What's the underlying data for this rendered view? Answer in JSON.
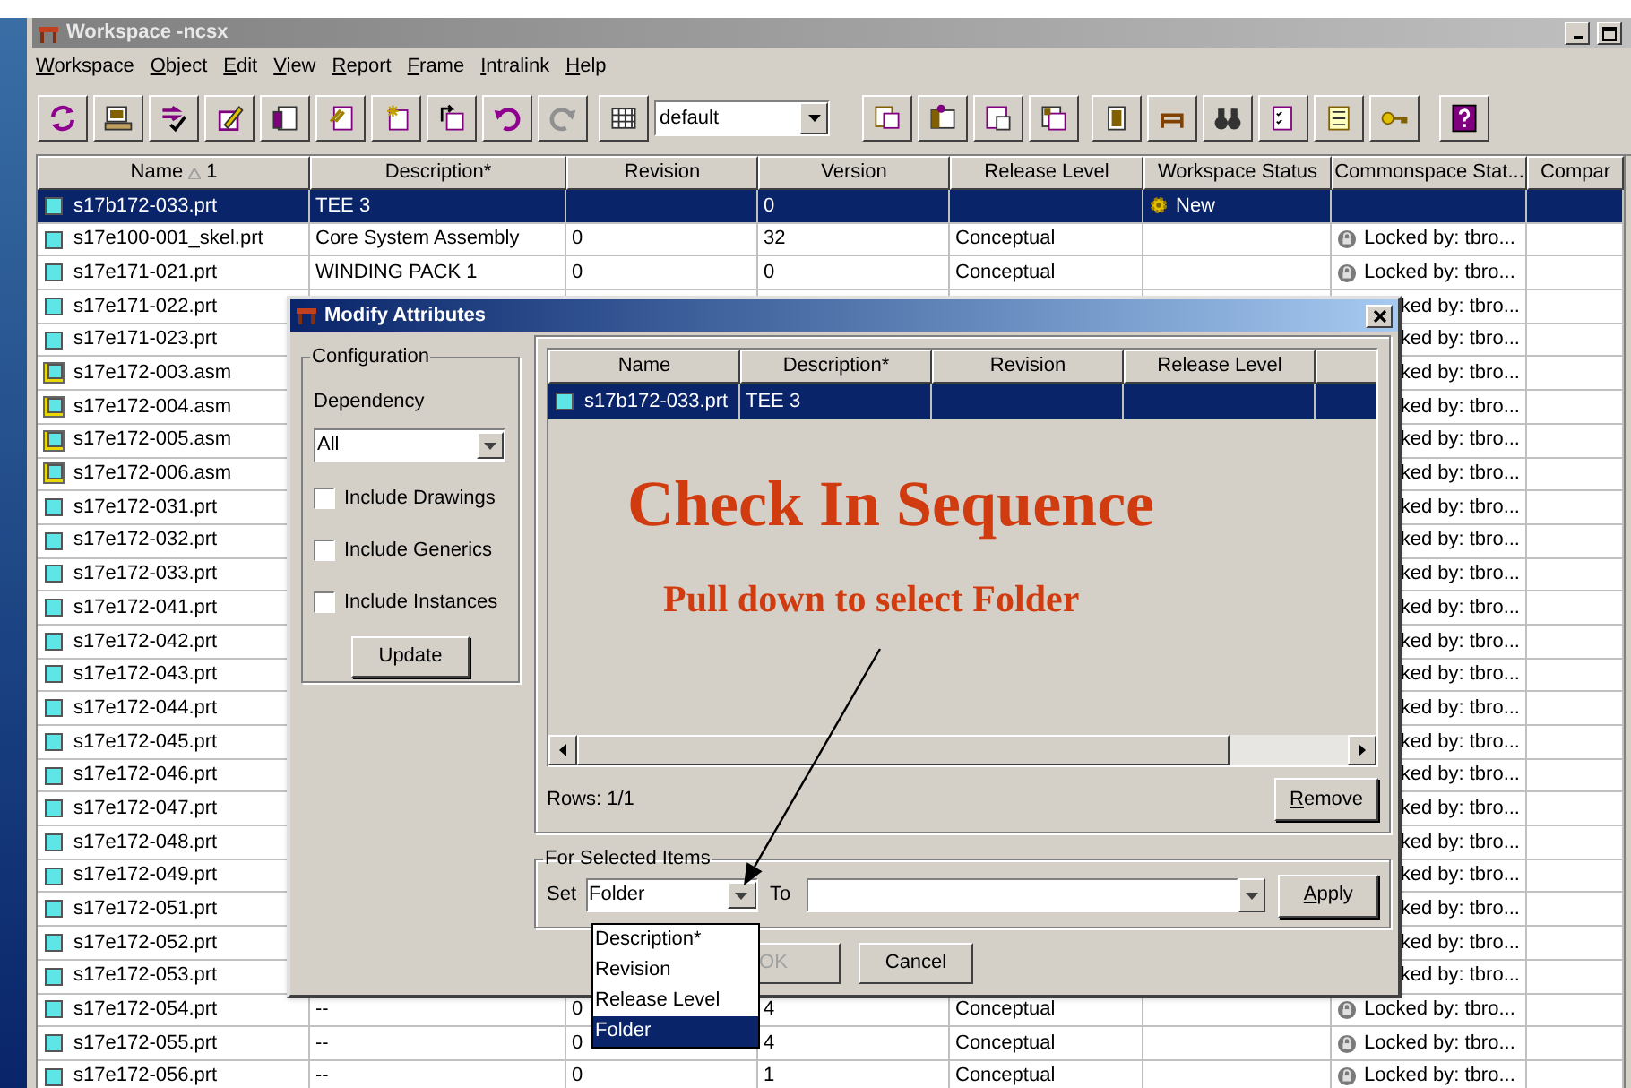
{
  "window": {
    "title": "Workspace -ncsx"
  },
  "menu": [
    "Workspace",
    "Object",
    "Edit",
    "View",
    "Report",
    "Frame",
    "Intralink",
    "Help"
  ],
  "toolbar": {
    "view_select": "default"
  },
  "table": {
    "columns": [
      {
        "label": "Name",
        "sort": "1"
      },
      {
        "label": "Description*"
      },
      {
        "label": "Revision"
      },
      {
        "label": "Version"
      },
      {
        "label": "Release Level"
      },
      {
        "label": "Workspace Status"
      },
      {
        "label": "Commonspace Stat..."
      },
      {
        "label": "Compar"
      }
    ],
    "rows": [
      {
        "kind": "prt",
        "name": "s17b172-033.prt",
        "description": "TEE 3",
        "version": "0",
        "workspace_status": "New",
        "lock": false,
        "selected": true
      },
      {
        "kind": "prt",
        "name": "s17e100-001_skel.prt",
        "description": "Core System Assembly",
        "revision": "0",
        "version": "32",
        "release_level": "Conceptual",
        "commonspace_status": "Locked by: tbro...",
        "lock": true,
        "selected": false
      },
      {
        "kind": "prt",
        "name": "s17e171-021.prt",
        "description": "WINDING PACK 1",
        "revision": "0",
        "version": "0",
        "release_level": "Conceptual",
        "commonspace_status": "Locked by: tbro...",
        "lock": true,
        "selected": false
      },
      {
        "kind": "prt",
        "name": "s17e171-022.prt",
        "commonspace_status": "ked by: tbro...",
        "lock": false,
        "selected": false
      },
      {
        "kind": "prt",
        "name": "s17e171-023.prt",
        "commonspace_status": "ked by: tbro...",
        "lock": false,
        "selected": false
      },
      {
        "kind": "asm",
        "name": "s17e172-003.asm",
        "commonspace_status": "ked by: tbro...",
        "lock": false,
        "selected": false
      },
      {
        "kind": "asm",
        "name": "s17e172-004.asm",
        "commonspace_status": "ked by: tbro...",
        "lock": false,
        "selected": false
      },
      {
        "kind": "asm",
        "name": "s17e172-005.asm",
        "commonspace_status": "ked by: tbro...",
        "lock": false,
        "selected": false
      },
      {
        "kind": "asm",
        "name": "s17e172-006.asm",
        "commonspace_status": "ked by: tbro...",
        "lock": false,
        "selected": false
      },
      {
        "kind": "prt",
        "name": "s17e172-031.prt",
        "commonspace_status": "ked by: tbro...",
        "lock": false,
        "selected": false
      },
      {
        "kind": "prt",
        "name": "s17e172-032.prt",
        "commonspace_status": "ked by: tbro...",
        "lock": false,
        "selected": false
      },
      {
        "kind": "prt",
        "name": "s17e172-033.prt",
        "commonspace_status": "ked by: tbro...",
        "lock": false,
        "selected": false
      },
      {
        "kind": "prt",
        "name": "s17e172-041.prt",
        "commonspace_status": "ked by: tbro...",
        "lock": false,
        "selected": false
      },
      {
        "kind": "prt",
        "name": "s17e172-042.prt",
        "commonspace_status": "ked by: tbro...",
        "lock": false,
        "selected": false
      },
      {
        "kind": "prt",
        "name": "s17e172-043.prt",
        "commonspace_status": "ked by: tbro...",
        "lock": false,
        "selected": false
      },
      {
        "kind": "prt",
        "name": "s17e172-044.prt",
        "commonspace_status": "ked by: tbro...",
        "lock": false,
        "selected": false
      },
      {
        "kind": "prt",
        "name": "s17e172-045.prt",
        "commonspace_status": "ked by: tbro...",
        "lock": false,
        "selected": false
      },
      {
        "kind": "prt",
        "name": "s17e172-046.prt",
        "commonspace_status": "ked by: tbro...",
        "lock": false,
        "selected": false
      },
      {
        "kind": "prt",
        "name": "s17e172-047.prt",
        "commonspace_status": "ked by: tbro...",
        "lock": false,
        "selected": false
      },
      {
        "kind": "prt",
        "name": "s17e172-048.prt",
        "commonspace_status": "ked by: tbro...",
        "lock": false,
        "selected": false
      },
      {
        "kind": "prt",
        "name": "s17e172-049.prt",
        "commonspace_status": "ked by: tbro...",
        "lock": false,
        "selected": false
      },
      {
        "kind": "prt",
        "name": "s17e172-051.prt",
        "commonspace_status": "ked by: tbro...",
        "lock": false,
        "selected": false
      },
      {
        "kind": "prt",
        "name": "s17e172-052.prt",
        "commonspace_status": "ked by: tbro...",
        "lock": false,
        "selected": false
      },
      {
        "kind": "prt",
        "name": "s17e172-053.prt",
        "commonspace_status": "ked by: tbro...",
        "lock": false,
        "selected": false
      },
      {
        "kind": "prt",
        "name": "s17e172-054.prt",
        "description": "--",
        "revision": "0",
        "version": "4",
        "release_level": "Conceptual",
        "commonspace_status": "Locked by: tbro...",
        "lock": true,
        "selected": false
      },
      {
        "kind": "prt",
        "name": "s17e172-055.prt",
        "description": "--",
        "revision": "0",
        "version": "4",
        "release_level": "Conceptual",
        "commonspace_status": "Locked by: tbro...",
        "lock": true,
        "selected": false
      },
      {
        "kind": "prt",
        "name": "s17e172-056.prt",
        "description": "--",
        "revision": "0",
        "version": "1",
        "release_level": "Conceptual",
        "commonspace_status": "Locked by: tbro...",
        "lock": true,
        "selected": false
      }
    ]
  },
  "dialog": {
    "title": "Modify Attributes",
    "configuration": {
      "title": "Configuration",
      "dependency_label": "Dependency",
      "dependency": "All",
      "update": "Update",
      "options": [
        {
          "label": "Include Drawings",
          "checked": false
        },
        {
          "label": "Include Generics",
          "checked": false
        },
        {
          "label": "Include Instances",
          "checked": false
        }
      ]
    },
    "items_table": {
      "columns": [
        "Name",
        "Description*",
        "Revision",
        "Release Level"
      ],
      "rows": [
        {
          "kind": "prt",
          "name": "s17b172-033.prt",
          "description": "TEE 3",
          "selected": true
        }
      ]
    },
    "rows_count": "Rows: 1/1",
    "remove": "Remove",
    "selected_items": {
      "title": "For Selected Items",
      "set_label": "Set",
      "set_value": "Folder",
      "to_label": "To",
      "apply": "Apply"
    },
    "ok": {
      "label": "OK",
      "disabled": true
    },
    "cancel": "Cancel",
    "set_options": [
      {
        "label": "Description*",
        "selected": false
      },
      {
        "label": "Revision",
        "selected": false
      },
      {
        "label": "Release Level",
        "selected": false
      },
      {
        "label": "Folder",
        "selected": true
      }
    ]
  },
  "annotations": {
    "title": "Check In Sequence",
    "subtitle": "Pull down to select Folder"
  }
}
